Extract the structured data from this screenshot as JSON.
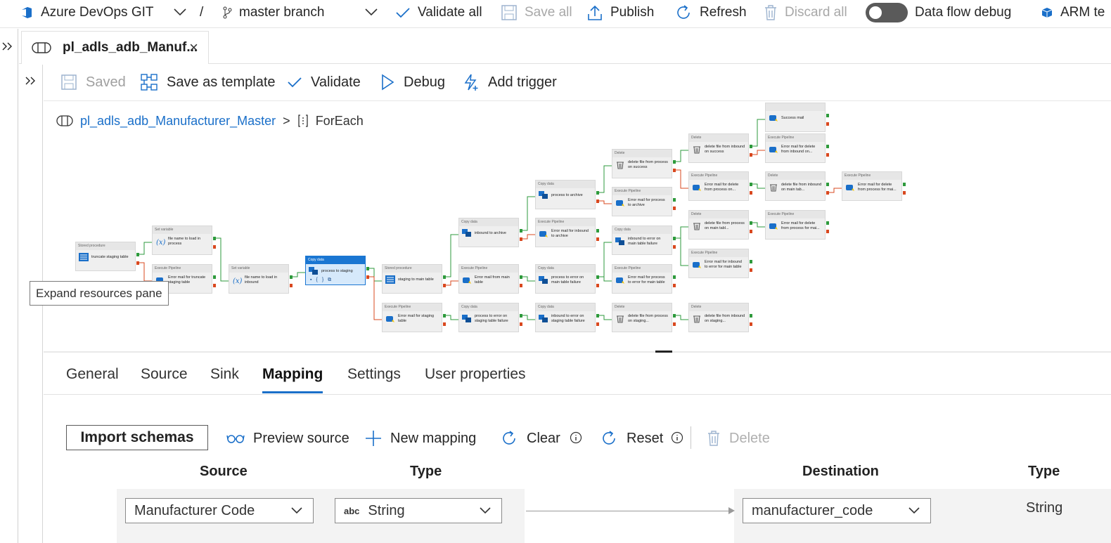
{
  "topbar": {
    "repo": "Azure DevOps GIT",
    "separator": "/",
    "branch": "master branch",
    "validate_all": "Validate all",
    "save_all": "Save all",
    "publish": "Publish",
    "refresh": "Refresh",
    "discard_all": "Discard all",
    "data_flow_debug": "Data flow debug",
    "data_flow_debug_on": false,
    "arm": "ARM te"
  },
  "tab": {
    "title": "pl_adls_adb_Manuf...",
    "close": "×"
  },
  "pipeline_toolbar": {
    "saved": "Saved",
    "save_as_template": "Save as template",
    "validate": "Validate",
    "debug": "Debug",
    "add_trigger": "Add trigger"
  },
  "breadcrumb": {
    "pipeline": "pl_adls_adb_Manufacturer_Master",
    "separator": ">",
    "activity": "ForEach"
  },
  "tooltip": "Expand resources pane",
  "activities": [
    {
      "id": "a1",
      "type": "Stored procedure",
      "name": "truncate staging table",
      "icon": "sproc"
    },
    {
      "id": "a2",
      "type": "Set variable",
      "name": "file name to load in process",
      "icon": "var"
    },
    {
      "id": "a3",
      "type": "Execute Pipeline",
      "name": "Error mail for truncate staging table",
      "icon": "exec"
    },
    {
      "id": "a4",
      "type": "Set variable",
      "name": "file name to load in inbound",
      "icon": "var"
    },
    {
      "id": "a5",
      "type": "Copy data",
      "name": "process to staging",
      "icon": "copy",
      "selected": true
    },
    {
      "id": "a6",
      "type": "Stored procedure",
      "name": "staging to main table",
      "icon": "sproc"
    },
    {
      "id": "a7",
      "type": "Execute Pipeline",
      "name": "Error mail for staging table",
      "icon": "exec"
    },
    {
      "id": "a8",
      "type": "Copy data",
      "name": "inbound to archive",
      "icon": "copy"
    },
    {
      "id": "a9",
      "type": "Execute Pipeline",
      "name": "Error mail from main table",
      "icon": "exec"
    },
    {
      "id": "a10",
      "type": "Copy data",
      "name": "process to error on staging table failure",
      "icon": "copy"
    },
    {
      "id": "a11",
      "type": "Copy data",
      "name": "process to archive",
      "icon": "copy"
    },
    {
      "id": "a12",
      "type": "Execute Pipeline",
      "name": "Error mail for inbound to archive",
      "icon": "exec"
    },
    {
      "id": "a13",
      "type": "Copy data",
      "name": "process to error on main table failure",
      "icon": "copy"
    },
    {
      "id": "a14",
      "type": "Copy data",
      "name": "inbound to error on staging table failure",
      "icon": "copy"
    },
    {
      "id": "a15",
      "type": "Delete",
      "name": "delete file from process on success",
      "icon": "del"
    },
    {
      "id": "a16",
      "type": "Execute Pipeline",
      "name": "Error mail for process to archive",
      "icon": "exec"
    },
    {
      "id": "a17",
      "type": "Copy data",
      "name": "inbound to error on main table failure",
      "icon": "copy"
    },
    {
      "id": "a18",
      "type": "Execute Pipeline",
      "name": "Error mail for process to error for main table",
      "icon": "exec"
    },
    {
      "id": "a19",
      "type": "Delete",
      "name": "delete file from process on staging...",
      "icon": "del"
    },
    {
      "id": "a20",
      "type": "Delete",
      "name": "delete file from inbound on success",
      "icon": "del"
    },
    {
      "id": "a21",
      "type": "Execute Pipeline",
      "name": "Error mail for delete from process on...",
      "icon": "exec"
    },
    {
      "id": "a22",
      "type": "Delete",
      "name": "delete file from process on main tabl...",
      "icon": "del"
    },
    {
      "id": "a23",
      "type": "Execute Pipeline",
      "name": "Error mail for inbound to error for main table",
      "icon": "exec"
    },
    {
      "id": "a24",
      "type": "Delete",
      "name": "delete file from inbound on staging...",
      "icon": "del"
    },
    {
      "id": "a25",
      "type": "",
      "name": "Success mail",
      "icon": "exec"
    },
    {
      "id": "a26",
      "type": "Execute Pipeline",
      "name": "Error mail for delete from inbound on...",
      "icon": "exec"
    },
    {
      "id": "a27",
      "type": "Delete",
      "name": "delete file from inbound on main tab...",
      "icon": "del"
    },
    {
      "id": "a28",
      "type": "Execute Pipeline",
      "name": "Error mail for delete from process for mai...",
      "icon": "exec"
    },
    {
      "id": "a29",
      "type": "Execute Pipeline",
      "name": "Error mail for delete from process for mai...",
      "icon": "exec"
    }
  ],
  "properties_tabs": [
    "General",
    "Source",
    "Sink",
    "Mapping",
    "Settings",
    "User properties"
  ],
  "active_tab": "Mapping",
  "mapping_toolbar": {
    "import_schemas": "Import schemas",
    "preview_source": "Preview source",
    "new_mapping": "New mapping",
    "clear": "Clear",
    "reset": "Reset",
    "delete": "Delete"
  },
  "mapping_columns": {
    "source": "Source",
    "source_type": "Type",
    "destination": "Destination",
    "destination_type": "Type"
  },
  "mapping_row": {
    "source": "Manufacturer Code",
    "type_badge": "abc",
    "type": "String",
    "destination": "manufacturer_code",
    "destination_type": "String"
  },
  "colors": {
    "accent": "#1a6fc9",
    "success": "#2e9a3c",
    "failure": "#d9481f"
  }
}
